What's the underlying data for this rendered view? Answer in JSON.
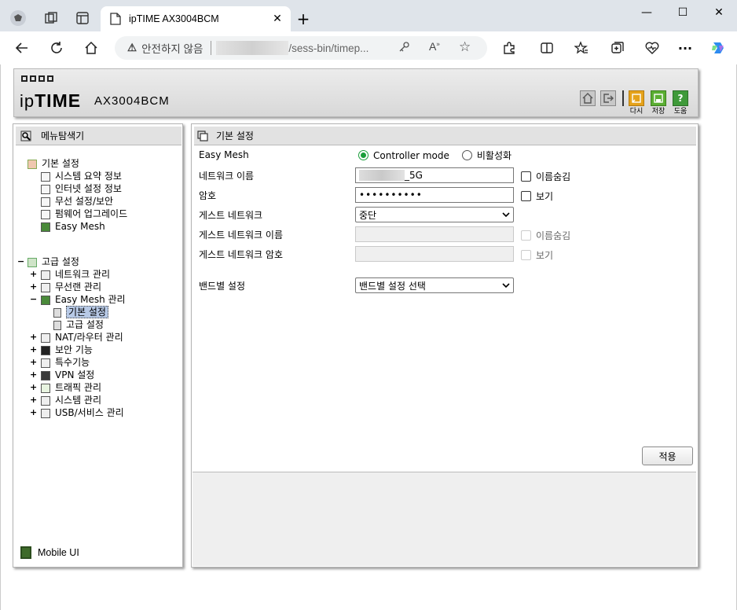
{
  "browser": {
    "tab_title": "ipTIME AX3004BCM",
    "tab_close": "✕",
    "new_tab": "+",
    "address_warning": "안전하지 않음",
    "address_url": "/sess-bin/timep...",
    "window_minimize": "—",
    "window_maximize": "☐",
    "window_close": "✕"
  },
  "header": {
    "brand_prefix": "ip",
    "brand_bold": "TIME",
    "model": "AX3004BCM",
    "buttons": [
      {
        "label": "다시",
        "color": "#e5a21a"
      },
      {
        "label": "저장",
        "color": "#5aae32"
      },
      {
        "label": "도움",
        "color": "#3f9a3a"
      }
    ]
  },
  "left": {
    "title": "메뉴탐색기",
    "basic": {
      "label": "기본 설정",
      "items": [
        "시스템 요약 정보",
        "인터넷 설정 정보",
        "무선 설정/보안",
        "펌웨어 업그레이드",
        "Easy Mesh"
      ]
    },
    "advanced": {
      "label": "고급 설정",
      "items": [
        {
          "label": "네트워크 관리",
          "toggle": "+"
        },
        {
          "label": "무선랜 관리",
          "toggle": "+"
        },
        {
          "label": "Easy Mesh 관리",
          "toggle": "−"
        },
        {
          "label": "NAT/라우터 관리",
          "toggle": "+"
        },
        {
          "label": "보안 기능",
          "toggle": "+"
        },
        {
          "label": "특수기능",
          "toggle": "+"
        },
        {
          "label": "VPN 설정",
          "toggle": "+"
        },
        {
          "label": "트래픽 관리",
          "toggle": "+"
        },
        {
          "label": "시스템 관리",
          "toggle": "+"
        },
        {
          "label": "USB/서비스 관리",
          "toggle": "+"
        }
      ],
      "mesh_children": [
        "기본 설정",
        "고급 설정"
      ],
      "toggle": "−"
    },
    "mobile_ui": "Mobile UI"
  },
  "right": {
    "title": "기본 설정",
    "easy_mesh_label": "Easy Mesh",
    "radio_controller": "Controller mode",
    "radio_disabled": "비활성화",
    "network_name_label": "네트워크 이름",
    "network_name_value": "_5G",
    "hide_name_label": "이름숨김",
    "password_label": "암호",
    "password_value": "••••••••••",
    "show_label": "보기",
    "guest_network_label": "게스트 네트워크",
    "guest_network_value": "중단",
    "guest_name_label": "게스트 네트워크 이름",
    "guest_hide_label": "이름숨김",
    "guest_password_label": "게스트 네트워크 암호",
    "guest_show_label": "보기",
    "band_label": "밴드별 설정",
    "band_value": "밴드별 설정 선택",
    "apply": "적용"
  },
  "colors": {
    "accent_green": "#1a9e3a",
    "selected_bg": "#b7c9e6"
  }
}
